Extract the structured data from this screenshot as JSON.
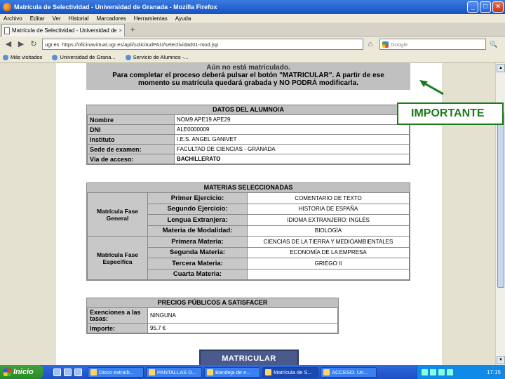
{
  "window": {
    "title": "Matrícula de Selectividad - Universidad de Granada - Mozilla Firefox",
    "buttons": {
      "minimize": "_",
      "maximize": "□",
      "close": "×"
    }
  },
  "menu": [
    "Archivo",
    "Editar",
    "Ver",
    "Historial",
    "Marcadores",
    "Herramientas",
    "Ayuda"
  ],
  "tab": {
    "label": "Matrícula de Selectividad - Universidad de Gr...",
    "close": "×",
    "new": "+"
  },
  "nav": {
    "back": "◀",
    "forward": "▶",
    "reload": "↻",
    "stop": "✕",
    "home": "⌂",
    "site": "ugr.es",
    "url": "https://oficinavirtual.ugr.es/apli/solicitudPAU/selectividad01-mod.jsp",
    "search_placeholder": "Google"
  },
  "bookmarks": [
    "Más visitados",
    "Universidad de Grana...",
    "Servicio de Alumnos -..."
  ],
  "notice": {
    "line1": "Aún no está matriculado.",
    "line2": "Para completar el proceso deberá pulsar el botón \"MATRICULAR\". A partir de ese",
    "line3": "momento su matrícula quedará grabada y NO PODRÁ modificarla."
  },
  "alumno": {
    "title": "DATOS DEL ALUMNO/A",
    "rows": [
      {
        "label": "Nombre",
        "value": "NOM9 APE19 APE29"
      },
      {
        "label": "DNI",
        "value": "ALE0000009"
      },
      {
        "label": "Instituto",
        "value": "I.E.S. ANGEL GANIVET"
      },
      {
        "label": "Sede de examen:",
        "value": "FACULTAD DE CIENCIAS - GRANADA"
      },
      {
        "label": "Vía de acceso:",
        "value": "BACHILLERATO"
      }
    ]
  },
  "materias": {
    "title": "MATERIAS SELECCIONADAS",
    "general": {
      "group": "Matrícula Fase General",
      "rows": [
        {
          "label": "Primer Ejercicio:",
          "value": "COMENTARIO DE TEXTO"
        },
        {
          "label": "Segundo Ejercicio:",
          "value": "HISTORIA DE ESPAÑA"
        },
        {
          "label": "Lengua Extranjera:",
          "value": "IDIOMA EXTRANJERO: INGLÉS"
        },
        {
          "label": "Materia de Modalidad:",
          "value": "BIOLOGÍA"
        }
      ]
    },
    "especifica": {
      "group": "Matrícula Fase Específica",
      "rows": [
        {
          "label": "Primera Materia:",
          "value": "CIENCIAS DE LA TIERRA Y MEDIOAMBIENTALES"
        },
        {
          "label": "Segunda Materia:",
          "value": "ECONOMÍA DE LA EMPRESA"
        },
        {
          "label": "Tercera Materia:",
          "value": "GRIEGO II"
        },
        {
          "label": "Cuarta Materia:",
          "value": ""
        }
      ]
    }
  },
  "precios": {
    "title": "PRECIOS PÚBLICOS A SATISFACER",
    "rows": [
      {
        "label": "Exenciones a las tasas:",
        "value": "NINGUNA"
      },
      {
        "label": "Importe:",
        "value": "95.7 €"
      }
    ]
  },
  "matricular_label": "MATRICULAR",
  "importante_label": "IMPORTANTE",
  "colors": {
    "accent_green": "#1d7a1d",
    "header_gray": "#c0c0c0",
    "taskbar_blue": "#1c4fc2"
  },
  "taskbar": {
    "start": "Inicio",
    "tasks": [
      "Disco extraíb...",
      "PANTALLAS D...",
      "Bandeja de e...",
      "Matrícula de S...",
      "ACCESO. Un..."
    ],
    "active_index": 3,
    "clock": "17:15"
  }
}
